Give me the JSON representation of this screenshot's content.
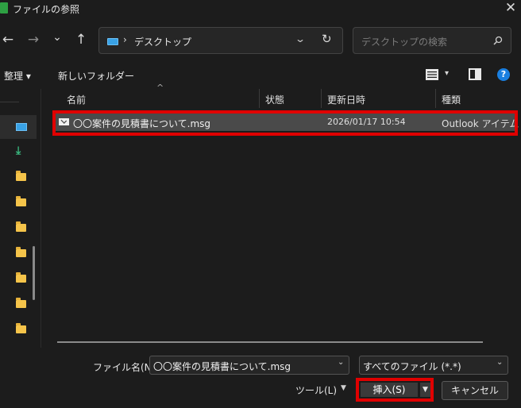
{
  "window": {
    "title": "ファイルの参照",
    "close_glyph": "✕",
    "icon": "excel-icon"
  },
  "nav": {
    "back_glyph": "←",
    "forward_glyph": "→",
    "recent_glyph": "⌄",
    "up_glyph": "↑",
    "address_chevron": "›",
    "address_text": "デスクトップ",
    "address_drop_glyph": "⌄",
    "refresh_glyph": "↻",
    "search_placeholder": "デスクトップの検索"
  },
  "toolbar": {
    "organize": "整理 ▾",
    "new_folder": "新しいフォルダー",
    "view_drop_glyph": "▾",
    "help_glyph": "?"
  },
  "sidebar": {
    "items": [
      {
        "icon": "desktop-icon"
      },
      {
        "icon": "download-icon",
        "glyph": "⤓"
      },
      {
        "icon": "folder-icon"
      },
      {
        "icon": "folder-icon"
      },
      {
        "icon": "folder-icon"
      },
      {
        "icon": "folder-icon"
      },
      {
        "icon": "folder-icon"
      },
      {
        "icon": "folder-icon"
      },
      {
        "icon": "folder-icon"
      }
    ]
  },
  "files": {
    "sort_glyph": "^",
    "columns": [
      "名前",
      "状態",
      "更新日時",
      "種類"
    ],
    "rows": [
      {
        "icon": "mail-icon",
        "name": "〇〇案件の見積書について.msg",
        "modified": "2026/01/17 10:54",
        "type": "Outlook アイテム"
      }
    ]
  },
  "bottom": {
    "filename_label": "ファイル名(N):",
    "filename_value": "〇〇案件の見積書について.msg",
    "filetype_value": "すべてのファイル (*.*)",
    "drop_glyph": "⌄",
    "tools_label": "ツール(L)",
    "tools_drop_glyph": "▼",
    "insert_label": "挿入(S)",
    "insert_split_glyph": "▼",
    "cancel_label": "キャンセル"
  },
  "colors": {
    "background": "#1c1c1c",
    "highlight_box": "#e00000",
    "selected_row": "#4a4a4a",
    "folder": "#f5c44a",
    "help": "#1a7fe0"
  }
}
